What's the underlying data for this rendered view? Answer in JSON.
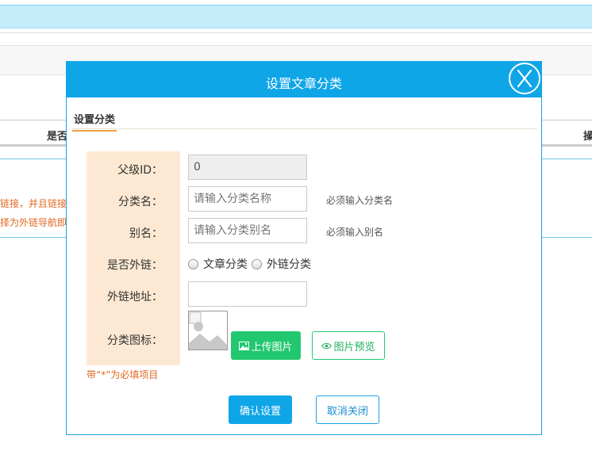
{
  "background": {
    "table_headers": {
      "is_external": "是否",
      "actions": "操"
    },
    "notes": [
      "链接，并且链接",
      "择为外链导航即"
    ]
  },
  "dialog": {
    "title": "设置文章分类",
    "close_icon": "close-icon",
    "tab_label": "设置分类",
    "fields": {
      "parent_id": {
        "label": "父级ID：",
        "value": "0"
      },
      "category_name": {
        "label": "分类名：",
        "placeholder": "请输入分类名称",
        "hint": "必须输入分类名"
      },
      "alias": {
        "label": "别名：",
        "placeholder": "请输入分类别名",
        "hint": "必须输入别名"
      },
      "is_external": {
        "label": "是否外链：",
        "options": [
          "文章分类",
          "外链分类"
        ]
      },
      "external_url": {
        "label": "外链地址：",
        "value": ""
      },
      "icon": {
        "label": "分类图标："
      }
    },
    "upload_button": "上传图片",
    "preview_button": "图片预览",
    "required_note": "带“*”为必填项目",
    "confirm_button": "确认设置",
    "cancel_button": "取消关闭",
    "colors": {
      "primary": "#0fa6e8",
      "green": "#22c870",
      "label_bg": "#fde9d3",
      "note": "#e06820"
    }
  }
}
